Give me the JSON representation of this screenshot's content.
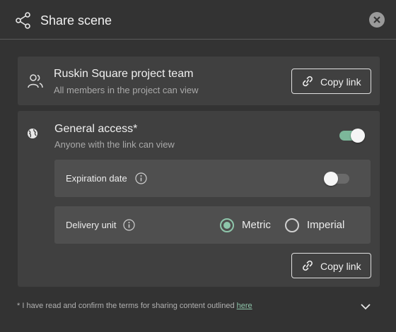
{
  "header": {
    "title": "Share scene",
    "share_icon": "share-icon",
    "close_icon": "close-icon"
  },
  "team": {
    "name": "Ruskin Square project team",
    "description": "All members in the project can view",
    "icon": "users-icon",
    "copy_link_label": "Copy link"
  },
  "general_access": {
    "title": "General access*",
    "description": "Anyone with the link can view",
    "icon": "globe-icon",
    "enabled": true,
    "expiration": {
      "label": "Expiration date",
      "enabled": false
    },
    "delivery_unit": {
      "label": "Delivery unit",
      "options": [
        "Metric",
        "Imperial"
      ],
      "selected": "Metric"
    },
    "copy_link_label": "Copy link"
  },
  "footer": {
    "terms_text": "* I have read and confirm the terms for sharing content outlined ",
    "terms_link": "here"
  },
  "colors": {
    "accent": "#8ec5aa",
    "toggle_on": "#7cb79a",
    "background": "#333333",
    "card": "#404040",
    "sub_row": "#4f4f4f"
  }
}
